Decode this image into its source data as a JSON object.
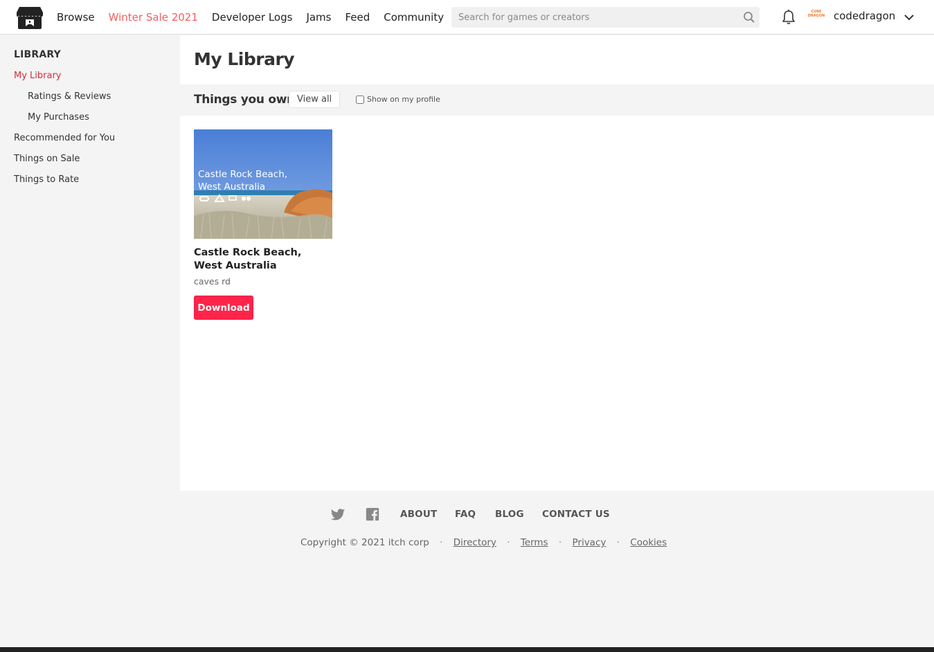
{
  "header": {
    "nav": {
      "browse": "Browse",
      "sale": "Winter Sale 2021",
      "devlogs": "Developer Logs",
      "jams": "Jams",
      "feed": "Feed",
      "community": "Community"
    },
    "search_placeholder": "Search for games or creators",
    "avatar_text": "CUBE DRAGON",
    "username": "codedragon",
    "sale_color": "#fa5c5c"
  },
  "sidebar": {
    "heading": "LIBRARY",
    "items": [
      {
        "label": "My Library",
        "active": true
      },
      {
        "label": "Ratings & Reviews"
      },
      {
        "label": "My Purchases"
      },
      {
        "label": "Recommended for You"
      },
      {
        "label": "Things on Sale"
      },
      {
        "label": "Things to Rate"
      }
    ]
  },
  "main": {
    "title": "My Library",
    "section_title": "Things you own",
    "view_all": "View all",
    "show_on_profile": "Show on my profile",
    "game": {
      "thumb_text_line1": "Castle Rock Beach,",
      "thumb_text_line2": "West Australia",
      "title": "Castle Rock Beach, West Australia",
      "author": "caves rd",
      "download": "Download",
      "download_color": "#ff2449"
    }
  },
  "footer": {
    "about": "ABOUT",
    "faq": "FAQ",
    "blog": "BLOG",
    "contact": "CONTACT US",
    "copyright": "Copyright © 2021 itch corp",
    "directory": "Directory",
    "terms": "Terms",
    "privacy": "Privacy",
    "cookies": "Cookies"
  }
}
